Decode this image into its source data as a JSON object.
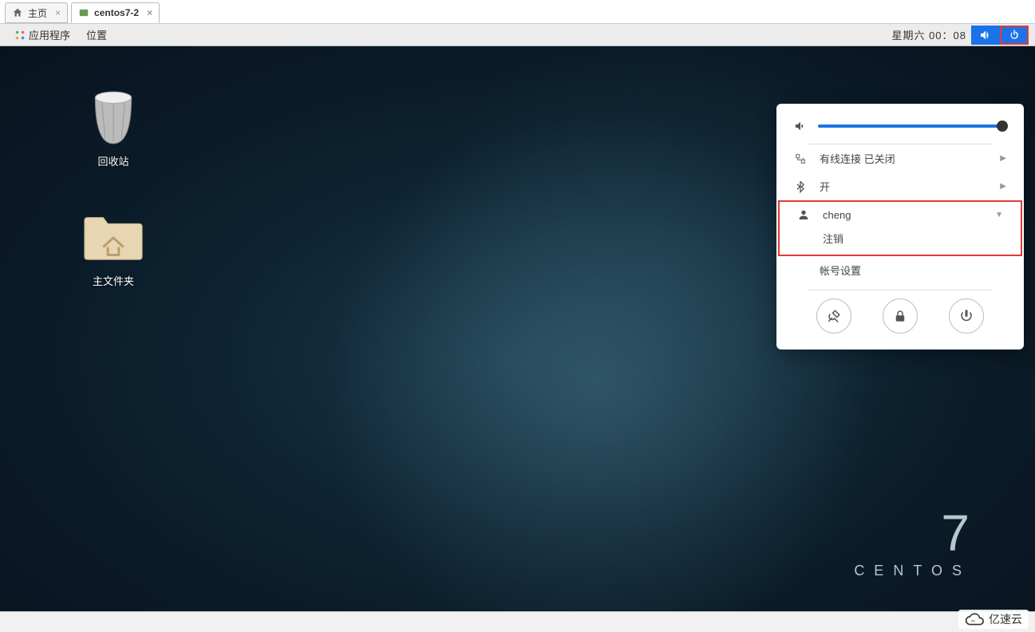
{
  "vm_tabs": {
    "home": "主页",
    "tab2": "centos7-2"
  },
  "topbar": {
    "applications": "应用程序",
    "places": "位置",
    "clock": "星期六 00：08"
  },
  "desktop_icons": {
    "trash": "回收站",
    "home": "主文件夹"
  },
  "brand": {
    "version": "7",
    "name": "CENTOS"
  },
  "sysmenu": {
    "wired": "有线连接 已关闭",
    "bluetooth": "开",
    "user": "cheng",
    "logout": "注销",
    "account_settings": "帐号设置"
  },
  "watermark": "亿速云"
}
